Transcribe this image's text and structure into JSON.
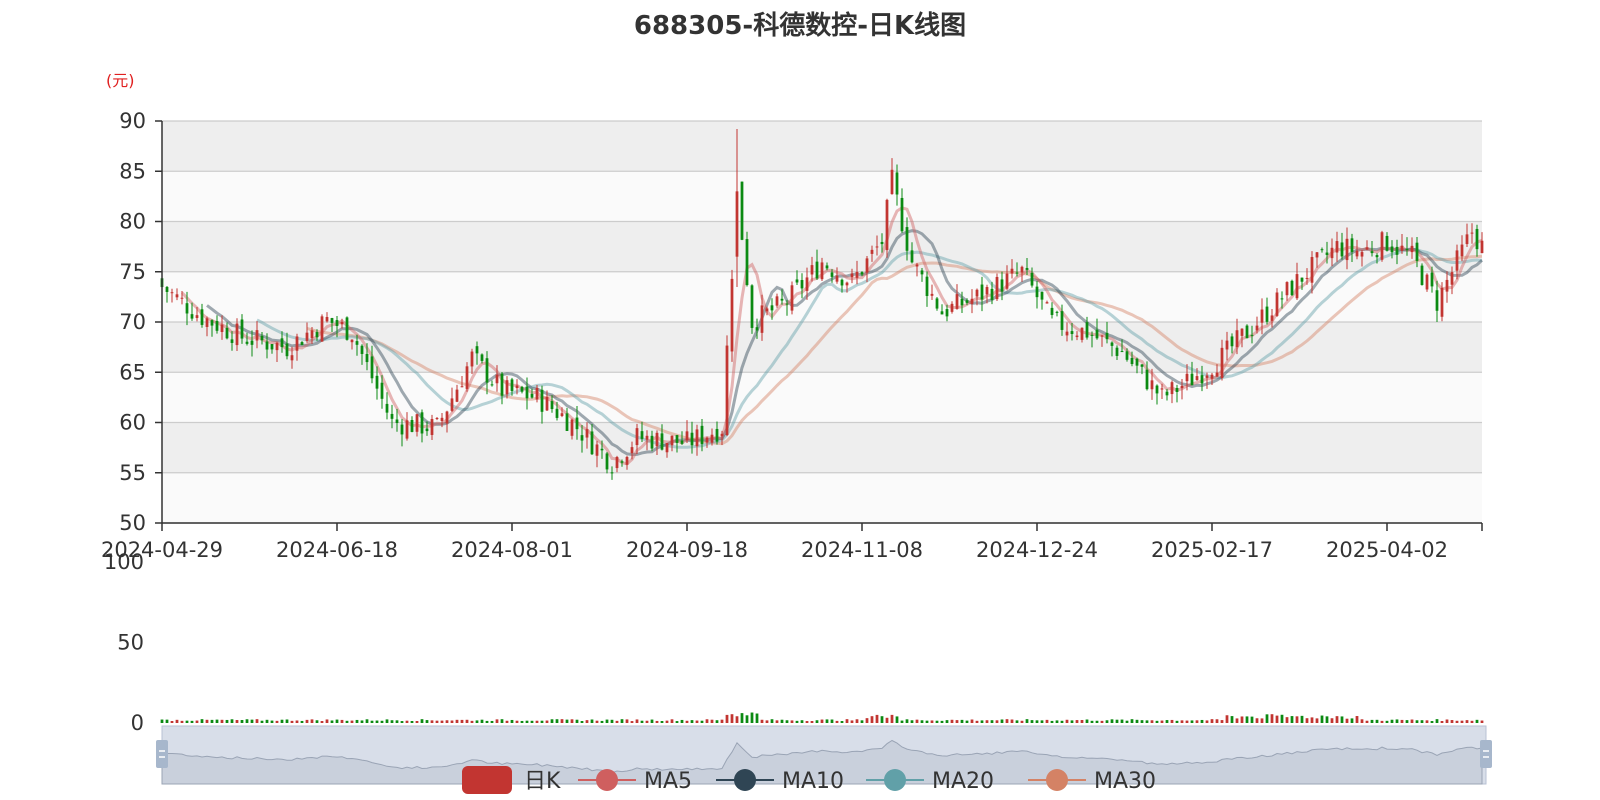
{
  "colors": {
    "up": "#c23531",
    "down": "#0b8a12",
    "ma5": "#cf5f5f",
    "ma10": "#2f4554",
    "ma20": "#61a0a8",
    "ma30": "#d48265",
    "grid_band": "#eeeeee",
    "grid_line": "#cccccc",
    "zoom_fill": "#d8dee9",
    "unit": "#e02020"
  },
  "chart_data": {
    "type": "candlestick",
    "title": "688305-科德数控-日K线图",
    "y_unit_label": "(元)",
    "price_axis": {
      "min": 50,
      "max": 90,
      "ticks": [
        "90",
        "85",
        "80",
        "75",
        "70",
        "65",
        "60",
        "55",
        "50"
      ]
    },
    "volume_axis": {
      "min": 0,
      "max": 100,
      "ticks": [
        "100",
        "50",
        "0"
      ]
    },
    "x_tick_labels": [
      "2024-04-29",
      "2024-06-18",
      "2024-08-01",
      "2024-09-18",
      "2024-11-08",
      "2024-12-24",
      "2025-02-17",
      "2025-04-02"
    ],
    "x_tick_index": [
      0,
      35,
      70,
      105,
      140,
      175,
      210,
      245
    ],
    "bar_count": 265,
    "close_anchors": [
      [
        0,
        73.5
      ],
      [
        8,
        70.5
      ],
      [
        16,
        68.5
      ],
      [
        25,
        67.5
      ],
      [
        33,
        70.2
      ],
      [
        38,
        69.0
      ],
      [
        46,
        60.0
      ],
      [
        55,
        59.5
      ],
      [
        62,
        66.5
      ],
      [
        68,
        63.2
      ],
      [
        75,
        62.5
      ],
      [
        82,
        60.0
      ],
      [
        90,
        56.0
      ],
      [
        95,
        58.5
      ],
      [
        105,
        58.0
      ],
      [
        112,
        59.5
      ],
      [
        115,
        83.0
      ],
      [
        118,
        70.0
      ],
      [
        125,
        72.0
      ],
      [
        132,
        76.0
      ],
      [
        138,
        74.0
      ],
      [
        144,
        78.0
      ],
      [
        146,
        84.0
      ],
      [
        150,
        76.0
      ],
      [
        156,
        71.0
      ],
      [
        163,
        72.5
      ],
      [
        172,
        75.0
      ],
      [
        178,
        70.0
      ],
      [
        185,
        69.0
      ],
      [
        192,
        67.0
      ],
      [
        200,
        62.5
      ],
      [
        205,
        64.0
      ],
      [
        212,
        66.5
      ],
      [
        220,
        70.5
      ],
      [
        228,
        74.5
      ],
      [
        235,
        77.5
      ],
      [
        240,
        77.0
      ],
      [
        245,
        78.0
      ],
      [
        250,
        76.5
      ],
      [
        255,
        72.0
      ],
      [
        262,
        79.0
      ],
      [
        264,
        77.5
      ]
    ],
    "legend": [
      "日K",
      "MA5",
      "MA10",
      "MA20",
      "MA30"
    ]
  }
}
